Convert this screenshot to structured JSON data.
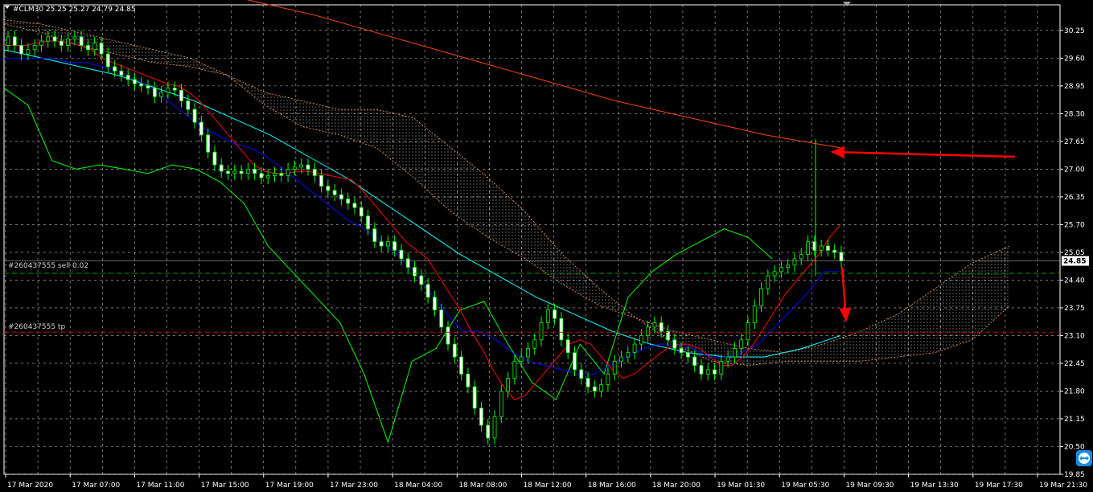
{
  "header": {
    "symbol_line": "#CLM30 25.25 25.27 24.79 24.85"
  },
  "colors": {
    "background": "#000000",
    "grid": "#c0c0c0",
    "candle_bull": "#00ff00",
    "candle_bear_body": "#ffffff",
    "tenkan": "#ff0000",
    "kijun": "#0000ff",
    "chikou": "#00ff00",
    "ma_cyan": "#00ffff",
    "ma_long": "#ff4500",
    "cloud": "#f4a460",
    "cloud_hatch": "#ffffff",
    "arrow": "#ff0000",
    "sell_line": "#00a000",
    "tp_line": "#c00000"
  },
  "orders": [
    {
      "label": "#260437555 sell 0.02",
      "price": 24.56
    },
    {
      "label": "#260437555 tp",
      "price": 23.18
    }
  ],
  "current_price": "24.85",
  "chart_data": {
    "type": "candlestick",
    "title": "",
    "y_ticks": [
      "30.25",
      "29.60",
      "28.95",
      "28.30",
      "27.65",
      "27.00",
      "26.35",
      "25.70",
      "25.05",
      "24.40",
      "23.75",
      "23.10",
      "22.45",
      "21.80",
      "21.15",
      "20.50",
      "19.85"
    ],
    "x_ticks": [
      "17 Mar 2020",
      "17 Mar 07:00",
      "17 Mar 11:00",
      "17 Mar 15:00",
      "17 Mar 19:00",
      "17 Mar 23:00",
      "18 Mar 04:00",
      "18 Mar 08:00",
      "18 Mar 12:00",
      "18 Mar 16:00",
      "18 Mar 20:00",
      "19 Mar 01:30",
      "19 Mar 05:30",
      "19 Mar 09:30",
      "19 Mar 13:30",
      "19 Mar 17:30",
      "19 Mar 21:30"
    ],
    "ylim": [
      19.85,
      30.85
    ],
    "grid": true,
    "close": [
      30.1,
      29.9,
      29.7,
      29.8,
      29.9,
      30.0,
      30.1,
      30.0,
      29.9,
      30.05,
      30.1,
      29.9,
      29.8,
      29.95,
      29.7,
      29.4,
      29.3,
      29.2,
      29.1,
      29.0,
      28.95,
      28.9,
      28.7,
      28.8,
      28.9,
      28.85,
      28.6,
      28.4,
      28.1,
      27.8,
      27.4,
      27.1,
      26.95,
      26.9,
      26.95,
      26.9,
      27.0,
      26.9,
      26.8,
      26.85,
      26.9,
      26.85,
      27.0,
      27.05,
      27.1,
      27.0,
      26.85,
      26.6,
      26.5,
      26.4,
      26.3,
      26.2,
      26.1,
      25.9,
      25.6,
      25.3,
      25.2,
      25.3,
      25.1,
      24.9,
      24.7,
      24.5,
      24.3,
      24.0,
      23.7,
      23.3,
      22.9,
      22.6,
      22.2,
      21.9,
      21.4,
      21.0,
      20.7,
      21.2,
      21.8,
      22.1,
      22.5,
      22.6,
      22.8,
      23.0,
      23.4,
      23.7,
      23.5,
      23.0,
      22.7,
      22.3,
      22.1,
      21.9,
      21.8,
      21.95,
      22.2,
      22.5,
      22.6,
      22.7,
      22.9,
      23.1,
      23.3,
      23.4,
      23.2,
      23.0,
      22.8,
      22.7,
      22.6,
      22.4,
      22.2,
      22.3,
      22.2,
      22.5,
      22.6,
      22.8,
      23.0,
      23.4,
      23.8,
      24.2,
      24.5,
      24.6,
      24.7,
      24.75,
      24.9,
      25.0,
      25.3,
      25.1,
      25.2,
      25.1,
      25.05,
      24.85
    ],
    "open": [
      29.9,
      30.1,
      29.9,
      29.7,
      29.8,
      29.9,
      30.0,
      30.1,
      30.0,
      29.9,
      30.05,
      30.1,
      29.9,
      29.8,
      29.95,
      29.7,
      29.4,
      29.3,
      29.2,
      29.1,
      29.0,
      28.95,
      28.9,
      28.7,
      28.8,
      28.9,
      28.85,
      28.6,
      28.4,
      28.1,
      27.8,
      27.4,
      27.1,
      26.95,
      26.9,
      26.95,
      26.9,
      27.0,
      26.9,
      26.8,
      26.85,
      26.9,
      26.85,
      27.0,
      27.05,
      27.1,
      27.0,
      26.85,
      26.6,
      26.5,
      26.4,
      26.3,
      26.2,
      26.1,
      25.9,
      25.6,
      25.3,
      25.2,
      25.3,
      25.1,
      24.9,
      24.7,
      24.5,
      24.3,
      24.0,
      23.7,
      23.3,
      22.9,
      22.6,
      22.2,
      21.9,
      21.4,
      21.0,
      20.7,
      21.2,
      21.8,
      22.1,
      22.5,
      22.6,
      22.8,
      23.0,
      23.4,
      23.7,
      23.5,
      23.0,
      22.7,
      22.3,
      22.1,
      21.9,
      21.8,
      21.95,
      22.2,
      22.5,
      22.6,
      22.7,
      22.9,
      23.1,
      23.3,
      23.4,
      23.2,
      23.0,
      22.8,
      22.7,
      22.6,
      22.4,
      22.2,
      22.3,
      22.2,
      22.5,
      22.6,
      22.8,
      23.0,
      23.4,
      23.8,
      24.2,
      24.5,
      24.6,
      24.7,
      24.75,
      24.9,
      25.0,
      25.3,
      25.1,
      25.2,
      25.1,
      25.05
    ],
    "tenkan": [
      29.9,
      29.9,
      29.9,
      29.95,
      30.0,
      30.0,
      29.95,
      29.9,
      29.8,
      29.6,
      29.5,
      29.4,
      29.3,
      29.2,
      29.1,
      29.0,
      28.95,
      28.8,
      28.6,
      28.3,
      28.0,
      27.7,
      27.4,
      27.1,
      26.95,
      26.9,
      26.9,
      26.95,
      26.95,
      26.9,
      26.85,
      26.8,
      26.75,
      26.5,
      26.2,
      25.9,
      25.6,
      25.3,
      25.1,
      24.9,
      24.5,
      24.1,
      23.7,
      23.2,
      22.8,
      22.3,
      21.9,
      21.6,
      21.7,
      22.0,
      22.3,
      22.6,
      22.9,
      23.0,
      22.9,
      22.6,
      22.3,
      22.1,
      22.2,
      22.4,
      22.6,
      22.8,
      22.9,
      22.9,
      22.8,
      22.6,
      22.4,
      22.4,
      22.6,
      22.9,
      23.3,
      23.7,
      24.1,
      24.4,
      24.7,
      25.0,
      25.4,
      25.7
    ],
    "kijun": [
      29.6,
      29.6,
      29.6,
      29.6,
      29.5,
      29.5,
      29.4,
      29.3,
      29.1,
      28.9,
      28.6,
      28.3,
      28.0,
      27.8,
      27.6,
      27.5,
      27.3,
      27.0,
      26.7,
      26.4,
      26.1,
      25.8,
      25.6,
      25.3,
      25.0,
      24.6,
      24.1,
      23.6,
      23.2,
      23.2,
      23.0,
      22.7,
      22.5,
      22.4,
      22.3,
      22.2,
      22.2,
      22.4,
      22.6,
      22.8,
      22.9,
      22.9,
      22.8,
      22.6,
      22.6,
      22.7,
      22.9,
      23.3,
      23.7,
      24.1,
      24.6,
      24.6
    ],
    "ma_cyan": [
      29.8,
      29.6,
      29.4,
      29.2,
      28.9,
      28.6,
      28.2,
      27.8,
      27.3,
      26.8,
      26.2,
      25.6,
      25.0,
      24.5,
      24.0,
      23.6,
      23.2,
      22.9,
      22.7,
      22.6,
      22.6,
      22.8,
      23.1
    ],
    "ma_long": [
      31.0,
      30.6,
      30.1,
      29.6,
      29.1,
      28.6,
      28.2,
      27.8,
      27.5
    ],
    "chikou": [
      28.9,
      28.5,
      27.2,
      27.0,
      27.1,
      27.0,
      26.9,
      27.1,
      27.0,
      26.7,
      26.2,
      25.2,
      24.6,
      24.0,
      23.4,
      22.2,
      20.6,
      22.5,
      22.8,
      23.7,
      23.9,
      22.9,
      22.0,
      21.6,
      22.9,
      22.2,
      24.0,
      24.6,
      25.0,
      25.3,
      25.6,
      25.4,
      24.9
    ],
    "cloud_a": [
      30.4,
      30.2,
      29.9,
      29.7,
      29.5,
      29.4,
      29.2,
      28.5,
      28.0,
      27.8,
      27.5,
      26.8,
      26.0,
      25.4,
      24.9,
      24.3,
      23.8,
      23.5,
      23.2,
      23.0,
      22.8,
      22.7,
      22.9,
      23.2,
      23.6,
      24.2,
      24.8,
      25.2
    ],
    "cloud_b": [
      30.5,
      30.4,
      30.2,
      30.0,
      29.8,
      29.6,
      29.2,
      28.8,
      28.6,
      28.4,
      28.4,
      28.2,
      27.5,
      26.8,
      26.0,
      25.0,
      24.2,
      23.5,
      22.9,
      22.5,
      22.4,
      22.5,
      22.5,
      22.5,
      22.6,
      22.7,
      23.0,
      23.8
    ]
  }
}
